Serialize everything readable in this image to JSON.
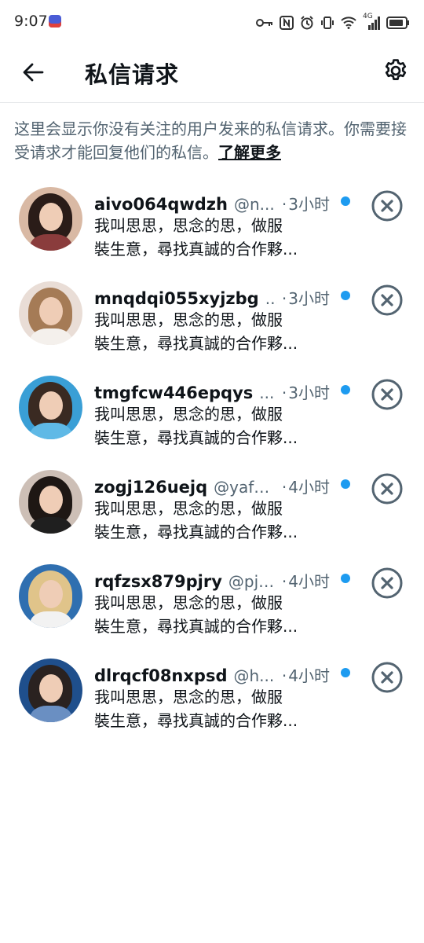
{
  "status_bar": {
    "time": "9:07",
    "network_label": "4G"
  },
  "header": {
    "title": "私信请求"
  },
  "info": {
    "text": "这里会显示你没有关注的用户发来的私信请求。你需要接受请求才能回复他们的私信。",
    "link": "了解更多"
  },
  "requests": [
    {
      "name": "aivo064qwdzh",
      "handle": "@n...",
      "separator": "·",
      "time": "3小时",
      "preview_line1": "我叫思思，思念的思，做服",
      "preview_line2": "裝生意，尋找真誠的合作夥...",
      "unread": true
    },
    {
      "name": "mnqdqi055xyjzbg",
      "handle": "...",
      "separator": "·",
      "time": "3小时",
      "preview_line1": "我叫思思，思念的思，做服",
      "preview_line2": "裝生意，尋找真誠的合作夥...",
      "unread": true
    },
    {
      "name": "tmgfcw446epqys",
      "handle": "...",
      "separator": "·",
      "time": "3小时",
      "preview_line1": "我叫思思，思念的思，做服",
      "preview_line2": "裝生意，尋找真誠的合作夥...",
      "unread": true
    },
    {
      "name": "zogj126uejq",
      "handle": "@yaf9...",
      "separator": "·",
      "time": "4小时",
      "preview_line1": "我叫思思，思念的思，做服",
      "preview_line2": "裝生意，尋找真誠的合作夥...",
      "unread": true
    },
    {
      "name": "rqfzsx879pjry",
      "handle": "@pjl...",
      "separator": "·",
      "time": "4小时",
      "preview_line1": "我叫思思，思念的思，做服",
      "preview_line2": "裝生意，尋找真誠的合作夥...",
      "unread": true
    },
    {
      "name": "dlrqcf08nxpsd",
      "handle": "@h...",
      "separator": "·",
      "time": "4小时",
      "preview_line1": "我叫思思，思念的思，做服",
      "preview_line2": "裝生意，尋找真誠的合作夥...",
      "unread": true
    }
  ],
  "icons": {
    "back": "arrow-left-icon",
    "settings": "gear-icon",
    "dismiss": "close-circle-icon",
    "unread": "unread-dot"
  },
  "colors": {
    "accent_blue": "#1d9bf0",
    "text_primary": "#0f1419",
    "text_secondary": "#536471",
    "icon_gray": "#536471",
    "divider": "#e6e9eb"
  }
}
